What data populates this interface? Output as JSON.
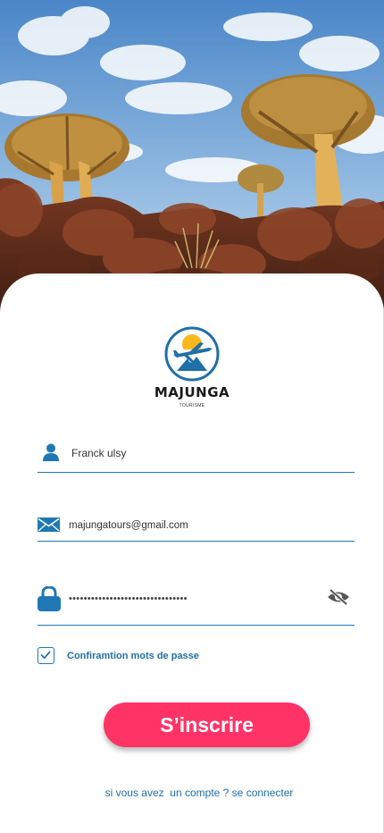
{
  "logo": {
    "title": "MAJUNGA",
    "subtitle": "TOURISME",
    "icon": "plane-sun-mountain-logo"
  },
  "form": {
    "name_value": "Franck ulsy",
    "email_value": "majungatours@gmail.com",
    "password_value": "••••••••••••••••••••••••••••••••",
    "confirm_label": "Confiramtion mots de passe",
    "confirm_checked": true
  },
  "submit_label": "S’inscrire",
  "login_link": "si vous avez  un compte ? se connecter",
  "colors": {
    "accent_blue": "#1f78b4",
    "button_pink": "#ff3366",
    "text_link": "#1f6fa8"
  },
  "icons": [
    "user-icon",
    "mail-icon",
    "lock-icon",
    "eye-off-icon",
    "check-icon"
  ]
}
